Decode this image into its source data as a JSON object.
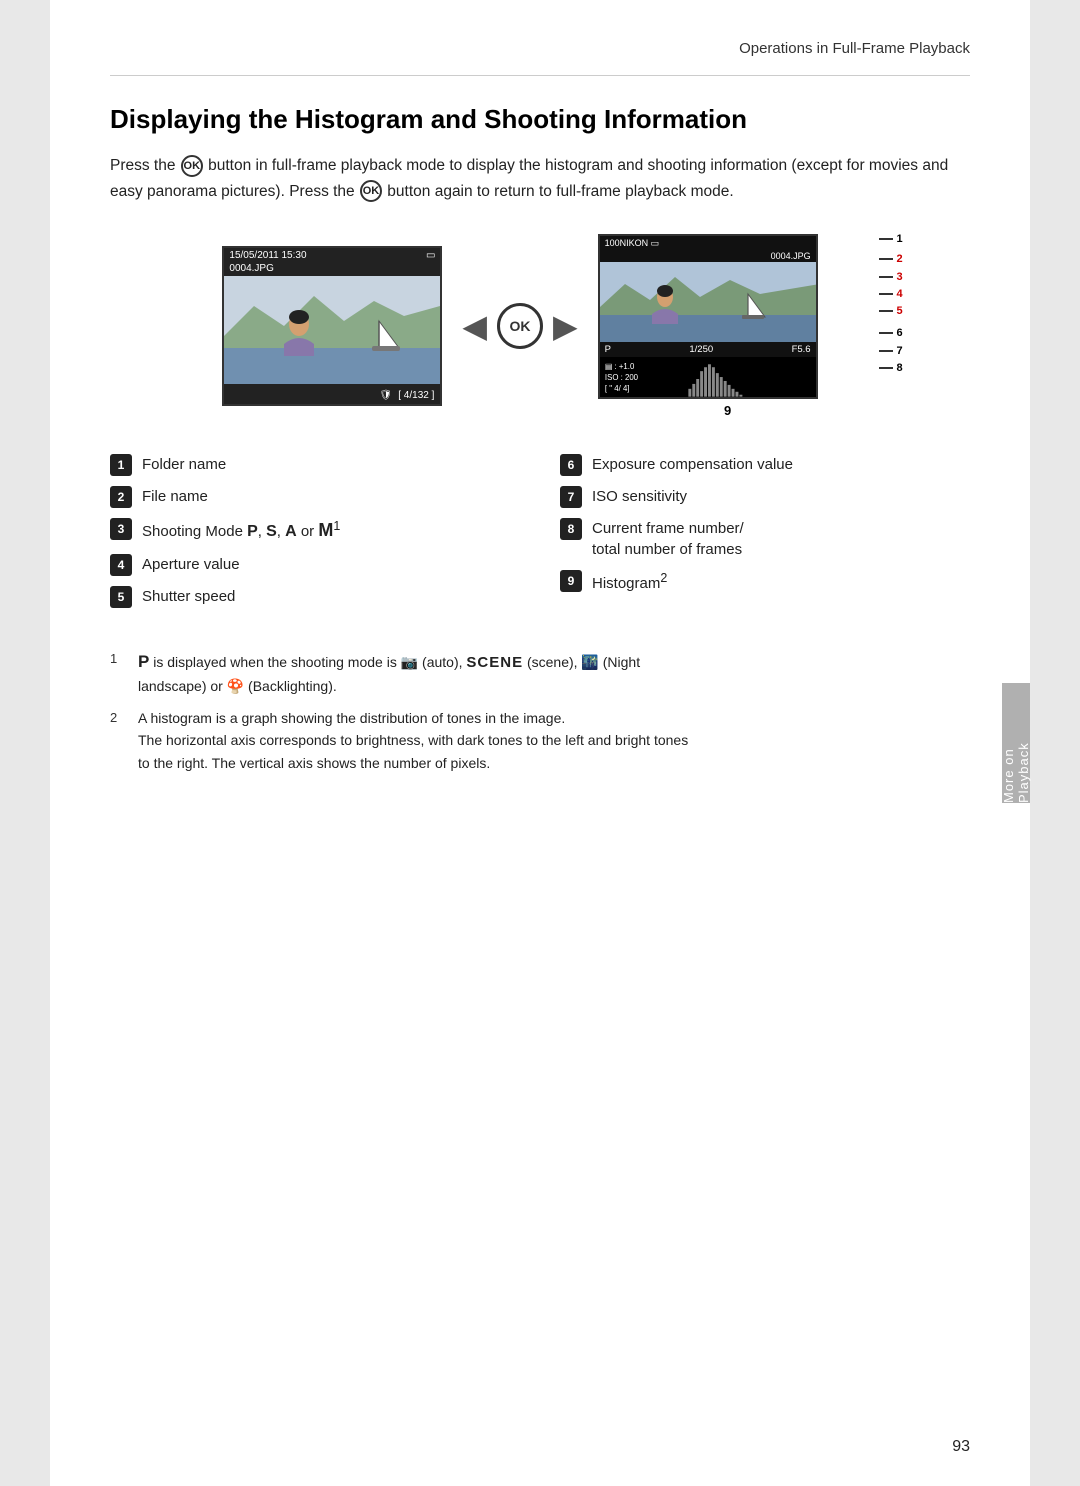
{
  "header": {
    "text": "Operations in Full-Frame Playback"
  },
  "title": "Displaying the Histogram and Shooting Information",
  "intro": {
    "part1": "Press the",
    "part2": "button in full-frame playback mode to display the histogram and shooting information (except for movies and easy panorama pictures). Press the",
    "part3": "button again to return to full-frame playback mode."
  },
  "diagram": {
    "left_screen": {
      "date": "15/05/2011 15:30",
      "filename": "0004.JPG",
      "frame_info": "4/132"
    },
    "right_screen": {
      "folder": "100NIKON",
      "filename": "0004.JPG",
      "mode": "P",
      "shutter": "1/250",
      "aperture": "F5.6",
      "exposure_comp": "+1.0",
      "iso": "200",
      "frame": "4/",
      "total": "4"
    },
    "number_9_label": "9"
  },
  "items": {
    "left_column": [
      {
        "num": "1",
        "label": "Folder name"
      },
      {
        "num": "2",
        "label": "File name"
      },
      {
        "num": "3",
        "label": "Shooting Mode P, S, A or M¹"
      },
      {
        "num": "4",
        "label": "Aperture value"
      },
      {
        "num": "5",
        "label": "Shutter speed"
      }
    ],
    "right_column": [
      {
        "num": "6",
        "label": "Exposure compensation value"
      },
      {
        "num": "7",
        "label": "ISO sensitivity"
      },
      {
        "num": "8",
        "label": "Current frame number/\ntotal number of frames"
      },
      {
        "num": "9",
        "label": "Histogram²"
      }
    ]
  },
  "footnotes": [
    {
      "num": "1",
      "text": "P is displayed when the shooting mode is 📷 (auto), SCENE (scene), 🌃 (Night landscape) or 🍄 (Backlighting)."
    },
    {
      "num": "2",
      "text": "A histogram is a graph showing the distribution of tones in the image.\nThe horizontal axis corresponds to brightness, with dark tones to the left and bright tones to the right. The vertical axis shows the number of pixels."
    }
  ],
  "sidebar": {
    "label": "More on Playback"
  },
  "page_number": "93"
}
